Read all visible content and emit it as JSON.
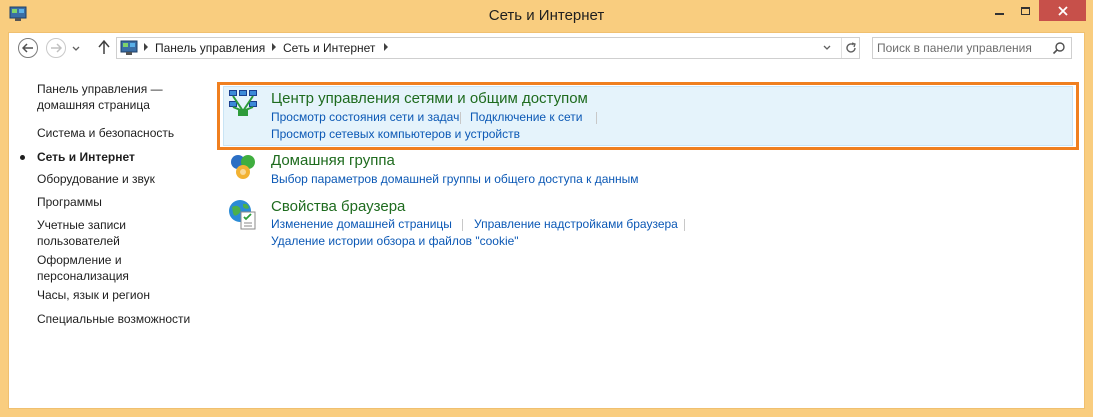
{
  "window": {
    "title": "Сеть и Интернет",
    "accent_color": "#f9cd7f",
    "close_color": "#c7504a"
  },
  "address": {
    "icon": "control-panel-icon",
    "crumbs": [
      "Панель управления",
      "Сеть и Интернет"
    ]
  },
  "search": {
    "placeholder": "Поиск в панели управления"
  },
  "sidebar": {
    "items": [
      {
        "label": "Панель управления — домашняя страница",
        "active": false
      },
      {
        "label": "Система и безопасность",
        "active": false
      },
      {
        "label": "Сеть и Интернет",
        "active": true
      },
      {
        "label": "Оборудование и звук",
        "active": false
      },
      {
        "label": "Программы",
        "active": false
      },
      {
        "label": "Учетные записи пользователей",
        "active": false
      },
      {
        "label": "Оформление и персонализация",
        "active": false
      },
      {
        "label": "Часы, язык и регион",
        "active": false
      },
      {
        "label": "Специальные возможности",
        "active": false
      }
    ]
  },
  "categories": [
    {
      "title": "Центр управления сетями и общим доступом",
      "icon": "network-center-icon",
      "links": [
        "Просмотр состояния сети и задач",
        "Подключение к сети",
        "Просмотр сетевых компьютеров и устройств"
      ],
      "highlighted": true
    },
    {
      "title": "Домашняя группа",
      "icon": "homegroup-icon",
      "links": [
        "Выбор параметров домашней группы и общего доступа к данным"
      ],
      "highlighted": false
    },
    {
      "title": "Свойства браузера",
      "icon": "internet-options-icon",
      "links": [
        "Изменение домашней страницы",
        "Управление надстройками браузера",
        "Удаление истории обзора и файлов \"cookie\""
      ],
      "highlighted": false
    }
  ],
  "highlight_color": "#f07f1f",
  "title_color": "#1e6b1e",
  "link_color": "#0b58b5"
}
